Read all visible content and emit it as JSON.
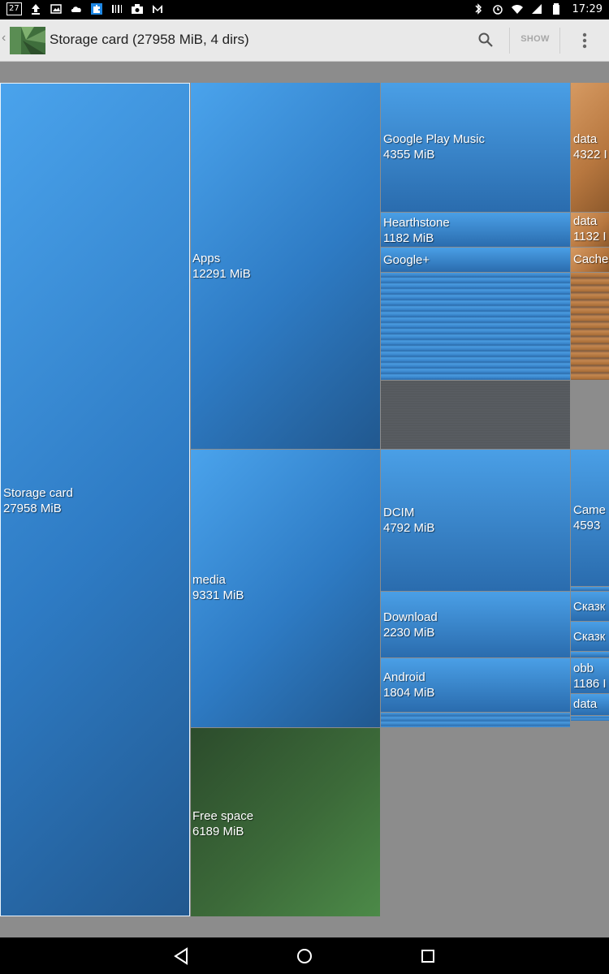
{
  "status_bar": {
    "notification_count": "27",
    "time": "17:29",
    "left_icons": [
      "upload-icon",
      "image-icon",
      "cloud-icon",
      "puzzle-icon",
      "barcode-icon",
      "camera-icon",
      "mail-icon"
    ],
    "right_icons": [
      "bluetooth-icon",
      "alarm-icon",
      "wifi-icon",
      "signal-icon",
      "battery-icon"
    ]
  },
  "action_bar": {
    "title": "Storage card (27958 MiB, 4 dirs)",
    "show_label": "SHOW",
    "back_glyph": "‹"
  },
  "treemap": {
    "root": {
      "name": "Storage card",
      "size": "27958 MiB",
      "color": "#3a8fd8"
    },
    "apps": {
      "name": "Apps",
      "size": "12291 MiB"
    },
    "media": {
      "name": "media",
      "size": "9331 MiB"
    },
    "free": {
      "name": "Free space",
      "size": "6189 MiB",
      "color": "#3f6e3c"
    },
    "gpm": {
      "name": "Google Play Music",
      "size": "4355 MiB"
    },
    "hearthstone": {
      "name": "Hearthstone",
      "size": "1182 MiB"
    },
    "gplus": {
      "name": "Google+"
    },
    "dcim": {
      "name": "DCIM",
      "size": "4792 MiB"
    },
    "download": {
      "name": "Download",
      "size": "2230 MiB"
    },
    "android": {
      "name": "Android",
      "size": "1804 MiB"
    },
    "data1": {
      "name": "data",
      "size": "4322 I"
    },
    "data2": {
      "name": "data",
      "size": "1132 I"
    },
    "cache": {
      "name": "Cache"
    },
    "camera": {
      "name": "Came",
      "size": "4593"
    },
    "skazk1": {
      "name": "Сказк"
    },
    "skazk2": {
      "name": "Сказк"
    },
    "obb": {
      "name": "obb",
      "size": "1186 I"
    },
    "data3": {
      "name": "data"
    },
    "accent_orange": "#c4874f",
    "accent_blue": "#3a8fd8"
  },
  "nav_bar": {
    "buttons": [
      "back-icon",
      "home-icon",
      "recents-icon"
    ]
  }
}
